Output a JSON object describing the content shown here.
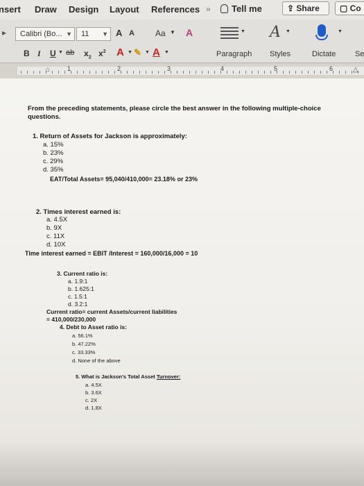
{
  "tabs": [
    "nsert",
    "Draw",
    "Design",
    "Layout",
    "References"
  ],
  "tell_me": "Tell me",
  "share": "Share",
  "comments": "Co",
  "ribbon": {
    "font_name": "Calibri (Bo...",
    "font_size": "11",
    "grow": "A",
    "shrink": "A",
    "case": "Aa",
    "bold": "B",
    "italic": "I",
    "underline": "U",
    "strike": "ab",
    "subscript": "x",
    "superscript": "x",
    "paragraph": "Paragraph",
    "styles": "Styles",
    "dictate": "Dictate",
    "sensitivity": "Se"
  },
  "ruler": [
    "1",
    "2",
    "3",
    "4",
    "5",
    "6"
  ],
  "doc": {
    "intro": "From the preceding statements, please circle the best answer in the following multiple-choice",
    "intro2": "questions.",
    "q1": "1.  Return of Assets for Jackson is approximately:",
    "q1_opts": [
      "a.  15%",
      "b.  23%",
      "c.  29%",
      "d.  35%"
    ],
    "q1_note": "EAT/Total Assets= 95,040/410,000= 23.18% or 23%",
    "q2": "2.  Times interest earned is:",
    "q2_opts": [
      "a.   4.5X",
      "b.  9X",
      "c.   11X",
      "d.  10X"
    ],
    "q2_note": "Time interest earned = EBIT /Interest = 160,000/16,000 = 10",
    "q3": "3.  Current ratio is:",
    "q3_opts": [
      "a.   1.9:1",
      "b.  1.625:1",
      "c.   1.5:1",
      "d.  3.2:1"
    ],
    "q3_note1": "Current ratio= current Assets/current liabilities",
    "q3_note2": "= 410,000/230,000",
    "q4": "4.  Debt to Asset ratio is:",
    "q4_opts": [
      "a.   56.1%",
      "b.  47.22%",
      "c.   33.33%",
      "d.  None of the above"
    ],
    "q5_pre": "5.  What is Jackson's Total Asset ",
    "q5_link": "Turnover:",
    "q5_opts": [
      "a.   4.5X",
      "b.  3.6X",
      "c.   2X",
      "d.  1.8X"
    ]
  }
}
